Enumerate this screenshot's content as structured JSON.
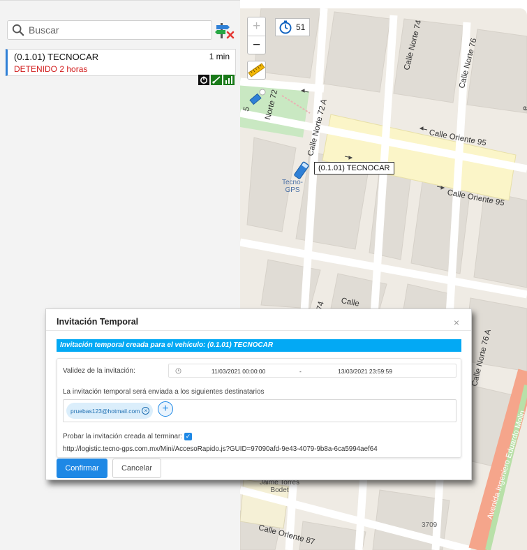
{
  "sidebar": {
    "search": {
      "placeholder": "Buscar",
      "icon": "search-icon"
    },
    "filter_icon": "clear-filter-icon",
    "vehicle": {
      "name": "(0.1.01) TECNOCAR",
      "last_update": "1 min",
      "status": "DETENIDO 2 horas",
      "status_color": "#d11a1a",
      "accent_color": "#2f80d6",
      "status_icons": [
        "power-icon",
        "signal-icon",
        "battery-icon"
      ]
    }
  },
  "map": {
    "zoom_in": "+",
    "zoom_out": "−",
    "refresh_countdown": "51",
    "vehicle_label": "(0.1.01) TECNOCAR",
    "poi_tecno_gps": [
      "Tecno-",
      "GPS"
    ],
    "poi_jaime": [
      "Jaime Torres",
      "Bodet"
    ],
    "streets": {
      "norte_74": "Calle Norte 74",
      "norte_76": "Calle Norte 76",
      "norte_72": "Norte 72",
      "norte_72a": "Calle Norte 72 A",
      "oriente_95_top": "Calle Oriente 95",
      "oriente_95_bottom": "Calle Oriente 95",
      "frag_74": "74",
      "calle_frag": "Calle",
      "norte_76a": "Calle Norte 76 A",
      "avenida": "Avenida Ingeniero Eduardo Molin",
      "oriente_87": "Calle Oriente 87",
      "number_3709": "3709",
      "frag_5": "5",
      "frag_e": "e"
    }
  },
  "modal": {
    "title": "Invitación Temporal",
    "info": "Invitación temporal creada para el vehículo: (0.1.01) TECNOCAR",
    "validity_label": "Validez de la invitación:",
    "date_start": "11/03/2021 00:00:00",
    "date_separator": "-",
    "date_end": "13/03/2021 23:59:59",
    "recipients_label": "La invitación temporal será enviada a los siguientes destinatarios",
    "recipients": [
      "pruebas123@hotmail.com"
    ],
    "test_label": "Probar la invitación creada al terminar:",
    "test_checked": true,
    "url": "http://logistic.tecno-gps.com.mx/Mini/AccesoRapido.js?GUID=97090afd-9e43-4079-9b8a-6ca5994aef64",
    "confirm_label": "Confirmar",
    "cancel_label": "Cancelar",
    "accent": "#1e88e5",
    "info_color": "#03a9f4"
  }
}
